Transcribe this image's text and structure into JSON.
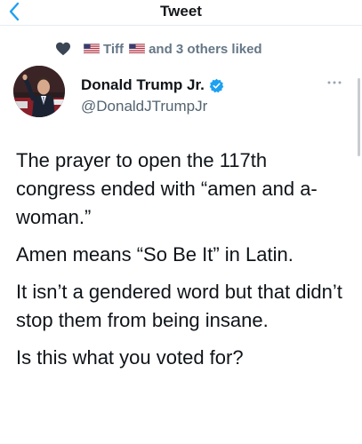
{
  "nav": {
    "title": "Tweet",
    "back_icon": "chevron-left-icon"
  },
  "social_context": {
    "icon": "heart-icon",
    "liker": "Tiff",
    "flag_icon": "us-flag-icon",
    "suffix": "and 3 others liked"
  },
  "author": {
    "name": "Donald Trump Jr.",
    "handle": "@DonaldJTrumpJr",
    "verified_icon": "verified-badge-icon",
    "more_icon": "more-options-icon"
  },
  "tweet": {
    "paragraphs": [
      "The prayer to open the 117th congress ended with “amen and a-woman.”",
      "Amen means “So Be It” in Latin.",
      "It isn’t a gendered word but that didn’t stop them from being insane.",
      "Is this what you voted for?"
    ]
  },
  "colors": {
    "accent": "#1da1f2",
    "secondary_text": "#657786",
    "heart": "#3a4653"
  }
}
